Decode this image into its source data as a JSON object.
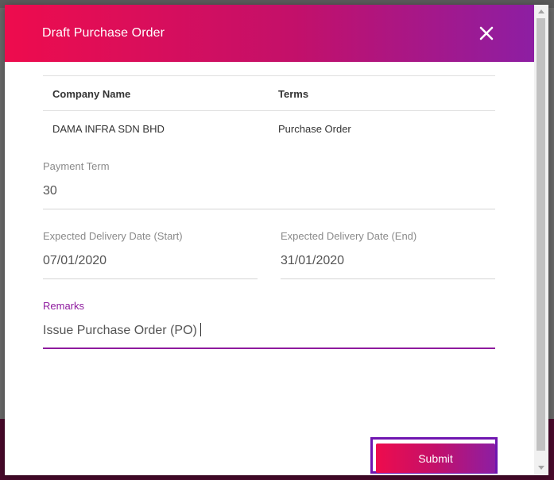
{
  "dialog": {
    "title": "Draft Purchase Order",
    "close_icon": "close-icon"
  },
  "table": {
    "headers": [
      "Company Name",
      "Terms"
    ],
    "rows": [
      [
        "DAMA INFRA SDN BHD",
        "Purchase Order"
      ]
    ]
  },
  "form": {
    "payment_term": {
      "label": "Payment Term",
      "value": "30"
    },
    "delivery_start": {
      "label": "Expected Delivery Date (Start)",
      "value": "07/01/2020"
    },
    "delivery_end": {
      "label": "Expected Delivery Date (End)",
      "value": "31/01/2020"
    },
    "remarks": {
      "label": "Remarks",
      "value": "Issue Purchase Order (PO)"
    }
  },
  "actions": {
    "submit_label": "Submit"
  },
  "colors": {
    "gradient_start": "#ee0c4d",
    "gradient_end": "#8d1ea3",
    "accent": "#8e1a9e",
    "focus_ring": "#6f15b0"
  }
}
